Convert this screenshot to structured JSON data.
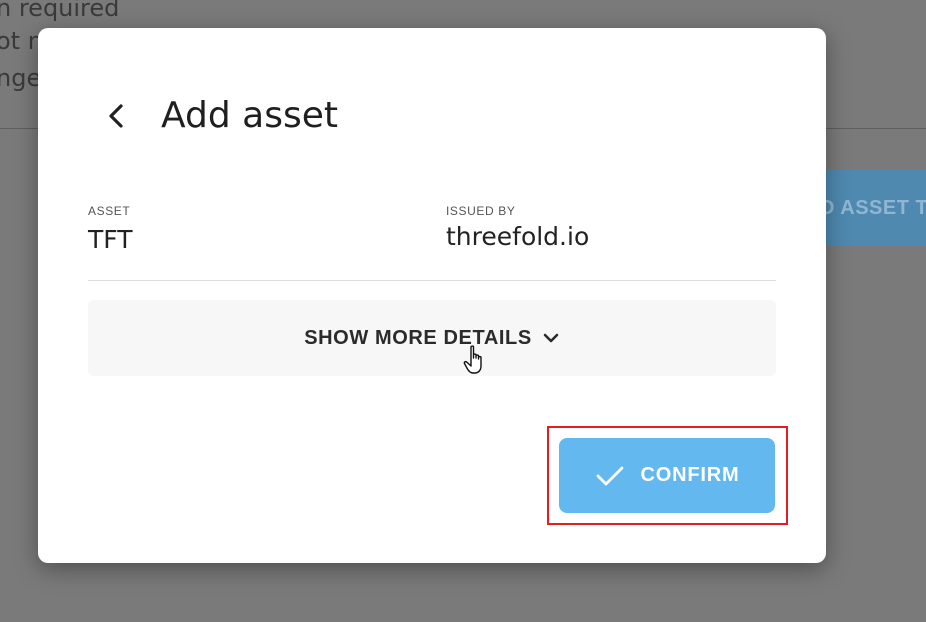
{
  "background": {
    "lines": [
      "n required",
      "ot n",
      "nge"
    ],
    "button_label": "D ASSET T"
  },
  "dialog": {
    "title": "Add asset",
    "back_icon": "chevron-left-icon",
    "asset": {
      "label": "ASSET",
      "value": "TFT"
    },
    "issuer": {
      "label": "ISSUED BY",
      "value": "threefold.io"
    },
    "details_toggle": {
      "label": "SHOW MORE DETAILS",
      "icon": "chevron-down-icon"
    },
    "confirm": {
      "label": "CONFIRM",
      "icon": "check-icon",
      "color": "#63b8ef"
    }
  },
  "highlight_color": "#e02020"
}
